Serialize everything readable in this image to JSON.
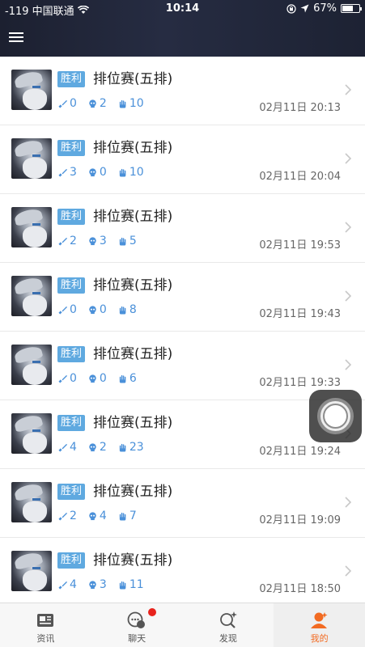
{
  "status_bar": {
    "carrier": "-119 中国联通",
    "time": "10:14",
    "battery": "67%",
    "battery_level": 0.67
  },
  "header": {
    "menu_icon": "hamburger-menu-icon"
  },
  "matches": [
    {
      "result": "胜利",
      "mode": "排位赛(五排)",
      "kills": "0",
      "deaths": "2",
      "assists": "10",
      "date": "02月11日 20:13"
    },
    {
      "result": "胜利",
      "mode": "排位赛(五排)",
      "kills": "3",
      "deaths": "0",
      "assists": "10",
      "date": "02月11日 20:04"
    },
    {
      "result": "胜利",
      "mode": "排位赛(五排)",
      "kills": "2",
      "deaths": "3",
      "assists": "5",
      "date": "02月11日 19:53"
    },
    {
      "result": "胜利",
      "mode": "排位赛(五排)",
      "kills": "0",
      "deaths": "0",
      "assists": "8",
      "date": "02月11日 19:43"
    },
    {
      "result": "胜利",
      "mode": "排位赛(五排)",
      "kills": "0",
      "deaths": "0",
      "assists": "6",
      "date": "02月11日 19:33"
    },
    {
      "result": "胜利",
      "mode": "排位赛(五排)",
      "kills": "4",
      "deaths": "2",
      "assists": "23",
      "date": "02月11日 19:24"
    },
    {
      "result": "胜利",
      "mode": "排位赛(五排)",
      "kills": "2",
      "deaths": "4",
      "assists": "7",
      "date": "02月11日 19:09"
    },
    {
      "result": "胜利",
      "mode": "排位赛(五排)",
      "kills": "4",
      "deaths": "3",
      "assists": "11",
      "date": "02月11日 18:50"
    }
  ],
  "tabs": [
    {
      "label": "资讯",
      "icon": "news-icon",
      "active": false,
      "badge": false
    },
    {
      "label": "聊天",
      "icon": "chat-icon",
      "active": false,
      "badge": true
    },
    {
      "label": "发现",
      "icon": "discover-icon",
      "active": false,
      "badge": false
    },
    {
      "label": "我的",
      "icon": "profile-icon",
      "active": true,
      "badge": false
    }
  ],
  "colors": {
    "accent_blue": "#4a90d9",
    "badge_blue": "#5fa9e0",
    "active_tab": "#f26b22",
    "notification_red": "#e8231d"
  }
}
